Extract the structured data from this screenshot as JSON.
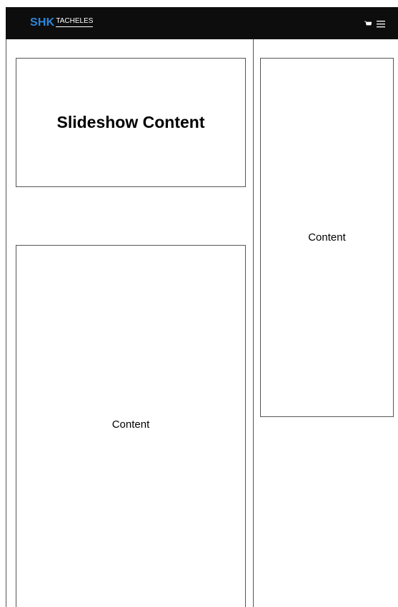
{
  "header": {
    "logo_primary": "SHK",
    "logo_secondary": "TACHELES",
    "brand_color": "#2b86d9",
    "background_color": "#0d0d0d",
    "icons": [
      "cart-icon",
      "hamburger-menu-icon"
    ]
  },
  "slideshow": {
    "title": "Slideshow Content"
  },
  "main": {
    "content_label": "Content"
  },
  "sidebar": {
    "content_label": "Content"
  }
}
